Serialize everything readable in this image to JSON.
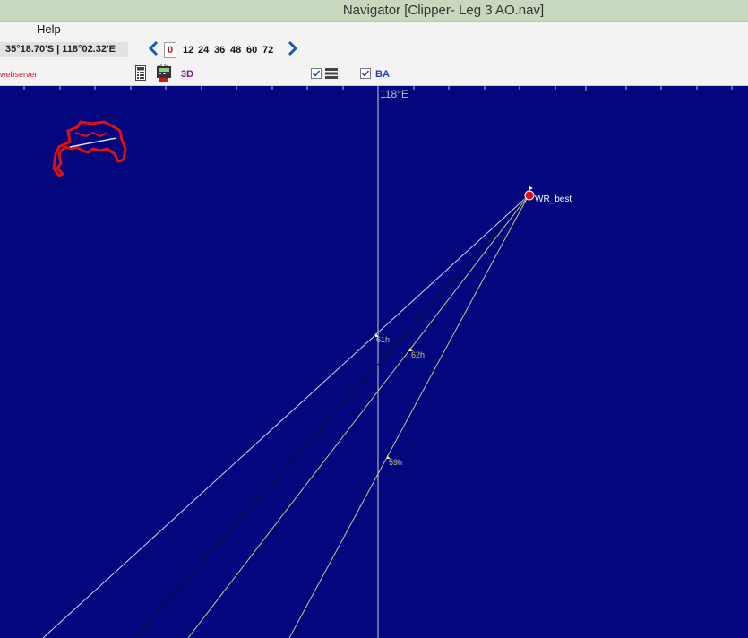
{
  "window": {
    "title": "Navigator [Clipper- Leg 3 AO.nav]"
  },
  "menu": {
    "help": "Help"
  },
  "toolbar": {
    "position": "35°18.70'S | 118°02.32'E",
    "current_hour": "0",
    "hours": [
      "12",
      "24",
      "36",
      "48",
      "60",
      "72"
    ],
    "webserver": "webserver",
    "view3d": "3D",
    "ba": "BA",
    "layers_checked": true,
    "ba_checked": true
  },
  "map": {
    "meridian_label": "118°E",
    "waypoint_label": "WR_best",
    "route_labels": [
      "61h",
      "62h",
      "59h"
    ],
    "colors": {
      "ocean": "#02077d",
      "land": "#e01010",
      "route": "#c9c48a",
      "route_white": "#cfd6f0",
      "meridian": "#c9cbe0"
    }
  }
}
